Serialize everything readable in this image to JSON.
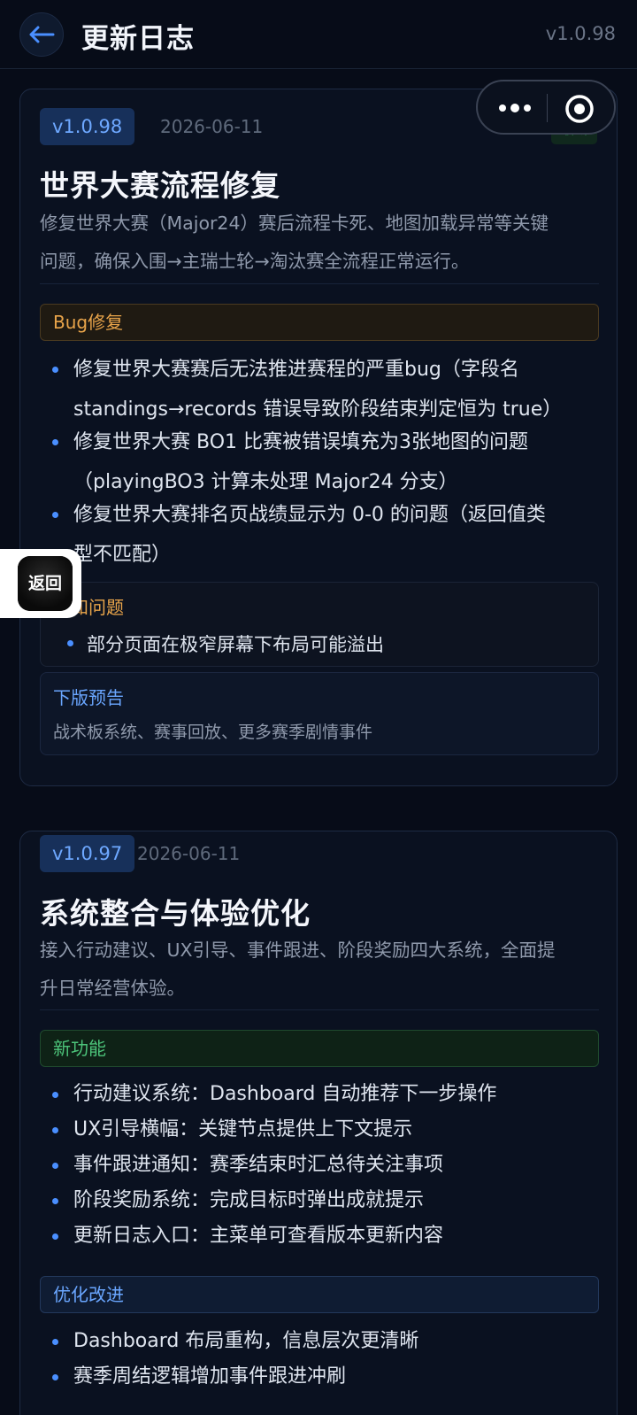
{
  "header": {
    "title": "更新日志",
    "version": "v1.0.98"
  },
  "releases": [
    {
      "version": "v1.0.98",
      "date": "2026-06-11",
      "badge": "最新",
      "title": "世界大赛流程修复",
      "desc_line1": "修复世界大赛（Major24）赛后流程卡死、地图加载异常等关键",
      "desc_line2": "问题，确保入围→主瑞士轮→淘汰赛全流程正常运行。",
      "section": "Bug修复",
      "items": [
        {
          "line1": "修复世界大赛赛后无法推进赛程的严重bug（字段名",
          "line2": "standings→records 错误导致阶段结束判定恒为 true）"
        },
        {
          "line1": "修复世界大赛 BO1 比赛被错误填充为3张地图的问题",
          "line2": "（playingBO3 计算未处理 Major24 分支）"
        },
        {
          "line1": "修复世界大赛排名页战绩显示为 0-0 的问题（返回值类",
          "line2": "型不匹配）"
        }
      ],
      "known_title": "已知问题",
      "known_items": [
        "部分页面在极窄屏幕下布局可能溢出"
      ],
      "next_title": "下版预告",
      "next_text": "战术板系统、赛事回放、更多赛季剧情事件"
    },
    {
      "version": "v1.0.97",
      "date": "2026-06-11",
      "title": "系统整合与体验优化",
      "desc_line1": "接入行动建议、UX引导、事件跟进、阶段奖励四大系统，全面提",
      "desc_line2": "升日常经营体验。",
      "section_new": "新功能",
      "new_items": [
        "行动建议系统：Dashboard 自动推荐下一步操作",
        "UX引导横幅：关键节点提供上下文提示",
        "事件跟进通知：赛季结束时汇总待关注事项",
        "阶段奖励系统：完成目标时弹出成就提示",
        "更新日志入口：主菜单可查看版本更新内容"
      ],
      "section_opt": "优化改进",
      "opt_items": [
        "Dashboard 布局重构，信息层次更清晰",
        "赛季周结逻辑增加事件跟进冲刷"
      ]
    }
  ],
  "floating_back": {
    "label": "返回"
  },
  "icons": {
    "back": "arrow-left-icon",
    "more": "more-dots-icon",
    "target": "target-circle-icon"
  },
  "colors": {
    "background": "#070c18",
    "accent": "#4a8fff",
    "bug": "#e8a44a",
    "new": "#4cc47a"
  }
}
